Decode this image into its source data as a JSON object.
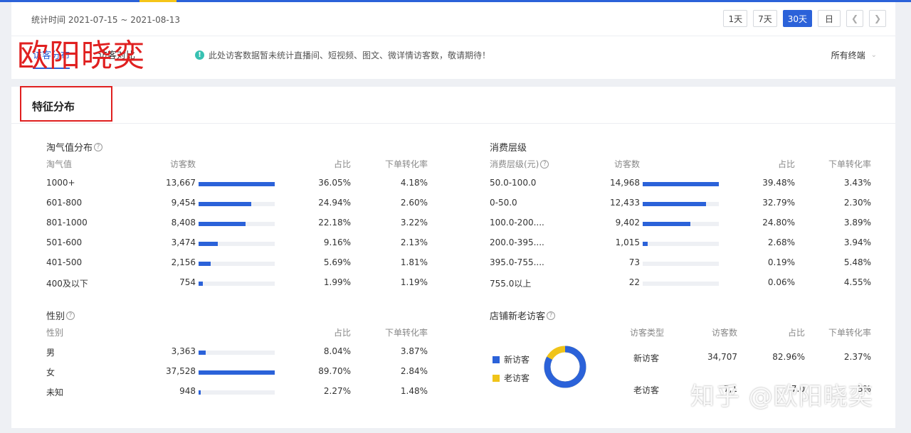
{
  "header": {
    "stat_time": "统计时间 2021-07-15 ~ 2021-08-13",
    "range_buttons": [
      "1天",
      "7天",
      "30天",
      "日"
    ],
    "active_range": "30天",
    "prev_icon": "chevron-left-icon",
    "next_icon": "chevron-right-icon"
  },
  "tabs": [
    "访客分布",
    "访客对比"
  ],
  "notice": "此处访客数据暂未统计直播间、短视频、图文、微详情访客数，敬请期待！",
  "terminal_select": "所有终端",
  "watermark_brand": "欧阳晓奕",
  "section_title": "特征分布",
  "naughty": {
    "title": "淘气值分布",
    "headers": [
      "淘气值",
      "访客数",
      "占比",
      "下单转化率"
    ],
    "rows": [
      {
        "label": "1000+",
        "visitors": "13,667",
        "share": "36.05%",
        "conv": "4.18%",
        "bar": 1.0
      },
      {
        "label": "601-800",
        "visitors": "9,454",
        "share": "24.94%",
        "conv": "2.60%",
        "bar": 0.69
      },
      {
        "label": "801-1000",
        "visitors": "8,408",
        "share": "22.18%",
        "conv": "3.22%",
        "bar": 0.62
      },
      {
        "label": "501-600",
        "visitors": "3,474",
        "share": "9.16%",
        "conv": "2.13%",
        "bar": 0.25
      },
      {
        "label": "401-500",
        "visitors": "2,156",
        "share": "5.69%",
        "conv": "1.81%",
        "bar": 0.16
      },
      {
        "label": "400及以下",
        "visitors": "754",
        "share": "1.99%",
        "conv": "1.19%",
        "bar": 0.055
      }
    ]
  },
  "spending": {
    "title": "消费层级",
    "headers": [
      "消费层级(元)",
      "访客数",
      "占比",
      "下单转化率"
    ],
    "rows": [
      {
        "label": "50.0-100.0",
        "visitors": "14,968",
        "share": "39.48%",
        "conv": "3.43%",
        "bar": 1.0
      },
      {
        "label": "0-50.0",
        "visitors": "12,433",
        "share": "32.79%",
        "conv": "2.30%",
        "bar": 0.83
      },
      {
        "label": "100.0-200....",
        "visitors": "9,402",
        "share": "24.80%",
        "conv": "3.89%",
        "bar": 0.63
      },
      {
        "label": "200.0-395....",
        "visitors": "1,015",
        "share": "2.68%",
        "conv": "3.94%",
        "bar": 0.068
      },
      {
        "label": "395.0-755....",
        "visitors": "73",
        "share": "0.19%",
        "conv": "5.48%",
        "bar": 0.0
      },
      {
        "label": "755.0以上",
        "visitors": "22",
        "share": "0.06%",
        "conv": "4.55%",
        "bar": 0.0
      }
    ]
  },
  "gender": {
    "title": "性别",
    "headers": [
      "性别",
      "占比",
      "下单转化率"
    ],
    "rows": [
      {
        "label": "男",
        "visitors": "3,363",
        "share": "8.04%",
        "conv": "3.87%",
        "bar": 0.09
      },
      {
        "label": "女",
        "visitors": "37,528",
        "share": "89.70%",
        "conv": "2.84%",
        "bar": 1.0
      },
      {
        "label": "未知",
        "visitors": "948",
        "share": "2.27%",
        "conv": "1.48%",
        "bar": 0.025
      }
    ]
  },
  "newold": {
    "title": "店铺新老访客",
    "legend": [
      {
        "label": "新访客",
        "color": "#2b62d9"
      },
      {
        "label": "老访客",
        "color": "#f0c419"
      }
    ],
    "donut_new_share": 0.8296,
    "headers": [
      "访客类型",
      "访客数",
      "占比",
      "下单转化率"
    ],
    "rows": [
      {
        "label": "新访客",
        "visitors": "34,707",
        "share": "82.96%",
        "conv": "2.37%"
      },
      {
        "label": "老访客",
        "visitors": "7,1",
        "share": "7.0",
        "conv": "3%"
      }
    ]
  },
  "watermark_zhihu": "知乎 @欧阳晓奕",
  "colors": {
    "accent": "#2b62d9",
    "yellow": "#f0c419",
    "red": "#e02020"
  }
}
